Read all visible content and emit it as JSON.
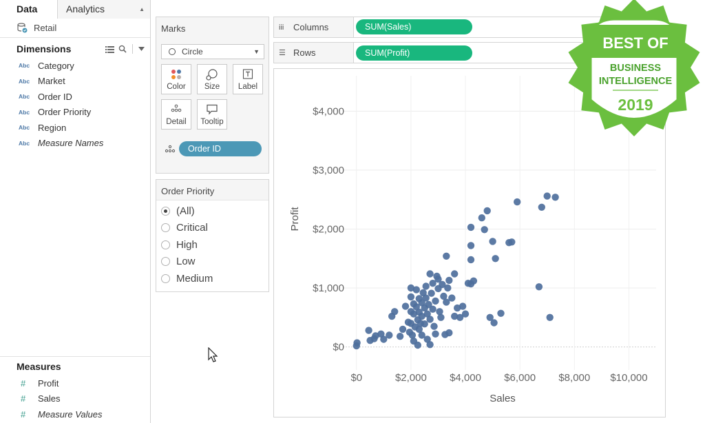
{
  "data_pane": {
    "tabs": [
      {
        "label": "Data",
        "active": true
      },
      {
        "label": "Analytics",
        "active": false
      }
    ],
    "datasource": "Retail",
    "dimensions": {
      "title": "Dimensions",
      "items": [
        {
          "type": "Abc",
          "label": "Category"
        },
        {
          "type": "Abc",
          "label": "Market"
        },
        {
          "type": "Abc",
          "label": "Order ID"
        },
        {
          "type": "Abc",
          "label": "Order Priority"
        },
        {
          "type": "Abc",
          "label": "Region"
        },
        {
          "type": "Abc",
          "label": "Measure Names"
        }
      ]
    },
    "measures": {
      "title": "Measures",
      "items": [
        {
          "type": "#",
          "label": "Profit"
        },
        {
          "type": "#",
          "label": "Sales"
        },
        {
          "type": "#",
          "label": "Measure Values"
        }
      ]
    }
  },
  "marks_card": {
    "title": "Marks",
    "mark_type": "Circle",
    "buttons": [
      "Color",
      "Size",
      "Label",
      "Detail",
      "Tooltip"
    ],
    "detail_pill": "Order ID"
  },
  "filter_card": {
    "title": "Order Priority",
    "options": [
      {
        "label": "(All)",
        "selected": true
      },
      {
        "label": "Critical",
        "selected": false
      },
      {
        "label": "High",
        "selected": false
      },
      {
        "label": "Low",
        "selected": false
      },
      {
        "label": "Medium",
        "selected": false
      }
    ]
  },
  "shelves": {
    "columns": {
      "label": "Columns",
      "pill": "SUM(Sales)"
    },
    "rows": {
      "label": "Rows",
      "pill": "SUM(Profit)"
    }
  },
  "badge": {
    "line1": "BEST OF",
    "line2": "BUSINESS",
    "line3": "INTELLIGENCE",
    "year": "2019",
    "color": "#6bbf3f"
  },
  "colors": {
    "mark": "#4e6f9c",
    "pill_green": "#19b77e",
    "pill_blue": "#4c98b6"
  },
  "chart_data": {
    "type": "scatter",
    "xlabel": "Sales",
    "ylabel": "Profit",
    "xlim": [
      -500,
      11000
    ],
    "ylim": [
      -250,
      4600
    ],
    "x_ticks": [
      0,
      2000,
      4000,
      6000,
      8000,
      10000
    ],
    "x_tick_labels": [
      "$0",
      "$2,000",
      "$4,000",
      "$6,000",
      "$8,000",
      "$10,000"
    ],
    "y_ticks": [
      0,
      1000,
      2000,
      3000,
      4000
    ],
    "y_tick_labels": [
      "$0",
      "$1,000",
      "$2,000",
      "$3,000",
      "$4,000"
    ],
    "grid": true,
    "points": [
      [
        0,
        20
      ],
      [
        20,
        70
      ],
      [
        450,
        280
      ],
      [
        500,
        110
      ],
      [
        700,
        190
      ],
      [
        900,
        220
      ],
      [
        650,
        140
      ],
      [
        1000,
        130
      ],
      [
        1200,
        200
      ],
      [
        1300,
        520
      ],
      [
        1400,
        600
      ],
      [
        1600,
        180
      ],
      [
        1700,
        300
      ],
      [
        1800,
        690
      ],
      [
        1900,
        420
      ],
      [
        1950,
        250
      ],
      [
        2000,
        1000
      ],
      [
        2000,
        850
      ],
      [
        2000,
        600
      ],
      [
        2000,
        400
      ],
      [
        2050,
        200
      ],
      [
        2100,
        730
      ],
      [
        2100,
        560
      ],
      [
        2100,
        100
      ],
      [
        2150,
        340
      ],
      [
        2200,
        970
      ],
      [
        2200,
        680
      ],
      [
        2250,
        460
      ],
      [
        2250,
        30
      ],
      [
        2300,
        820
      ],
      [
        2300,
        590
      ],
      [
        2300,
        300
      ],
      [
        2350,
        400
      ],
      [
        2400,
        750
      ],
      [
        2400,
        520
      ],
      [
        2400,
        200
      ],
      [
        2450,
        920
      ],
      [
        2500,
        660
      ],
      [
        2500,
        390
      ],
      [
        2550,
        1030
      ],
      [
        2550,
        830
      ],
      [
        2600,
        560
      ],
      [
        2600,
        130
      ],
      [
        2650,
        720
      ],
      [
        2700,
        1240
      ],
      [
        2700,
        470
      ],
      [
        2700,
        40
      ],
      [
        2750,
        910
      ],
      [
        2800,
        1080
      ],
      [
        2800,
        640
      ],
      [
        2850,
        350
      ],
      [
        2900,
        220
      ],
      [
        2900,
        780
      ],
      [
        2950,
        1200
      ],
      [
        3000,
        1150
      ],
      [
        3000,
        990
      ],
      [
        3050,
        600
      ],
      [
        3100,
        500
      ],
      [
        3150,
        1060
      ],
      [
        3200,
        860
      ],
      [
        3250,
        210
      ],
      [
        3300,
        1540
      ],
      [
        3300,
        760
      ],
      [
        3350,
        1000
      ],
      [
        3400,
        1130
      ],
      [
        3400,
        240
      ],
      [
        3500,
        830
      ],
      [
        3600,
        1240
      ],
      [
        3600,
        520
      ],
      [
        3700,
        660
      ],
      [
        3800,
        500
      ],
      [
        3900,
        690
      ],
      [
        4000,
        560
      ],
      [
        4100,
        1080
      ],
      [
        4200,
        1070
      ],
      [
        4300,
        1120
      ],
      [
        4200,
        2030
      ],
      [
        4200,
        1720
      ],
      [
        4200,
        1480
      ],
      [
        4600,
        2190
      ],
      [
        4700,
        1990
      ],
      [
        4800,
        2310
      ],
      [
        4900,
        500
      ],
      [
        5000,
        1790
      ],
      [
        5100,
        1500
      ],
      [
        5050,
        410
      ],
      [
        5300,
        570
      ],
      [
        5600,
        1770
      ],
      [
        5700,
        1780
      ],
      [
        5900,
        2460
      ],
      [
        6700,
        1020
      ],
      [
        6800,
        2370
      ],
      [
        7000,
        2560
      ],
      [
        7100,
        500
      ],
      [
        7300,
        2540
      ]
    ]
  }
}
